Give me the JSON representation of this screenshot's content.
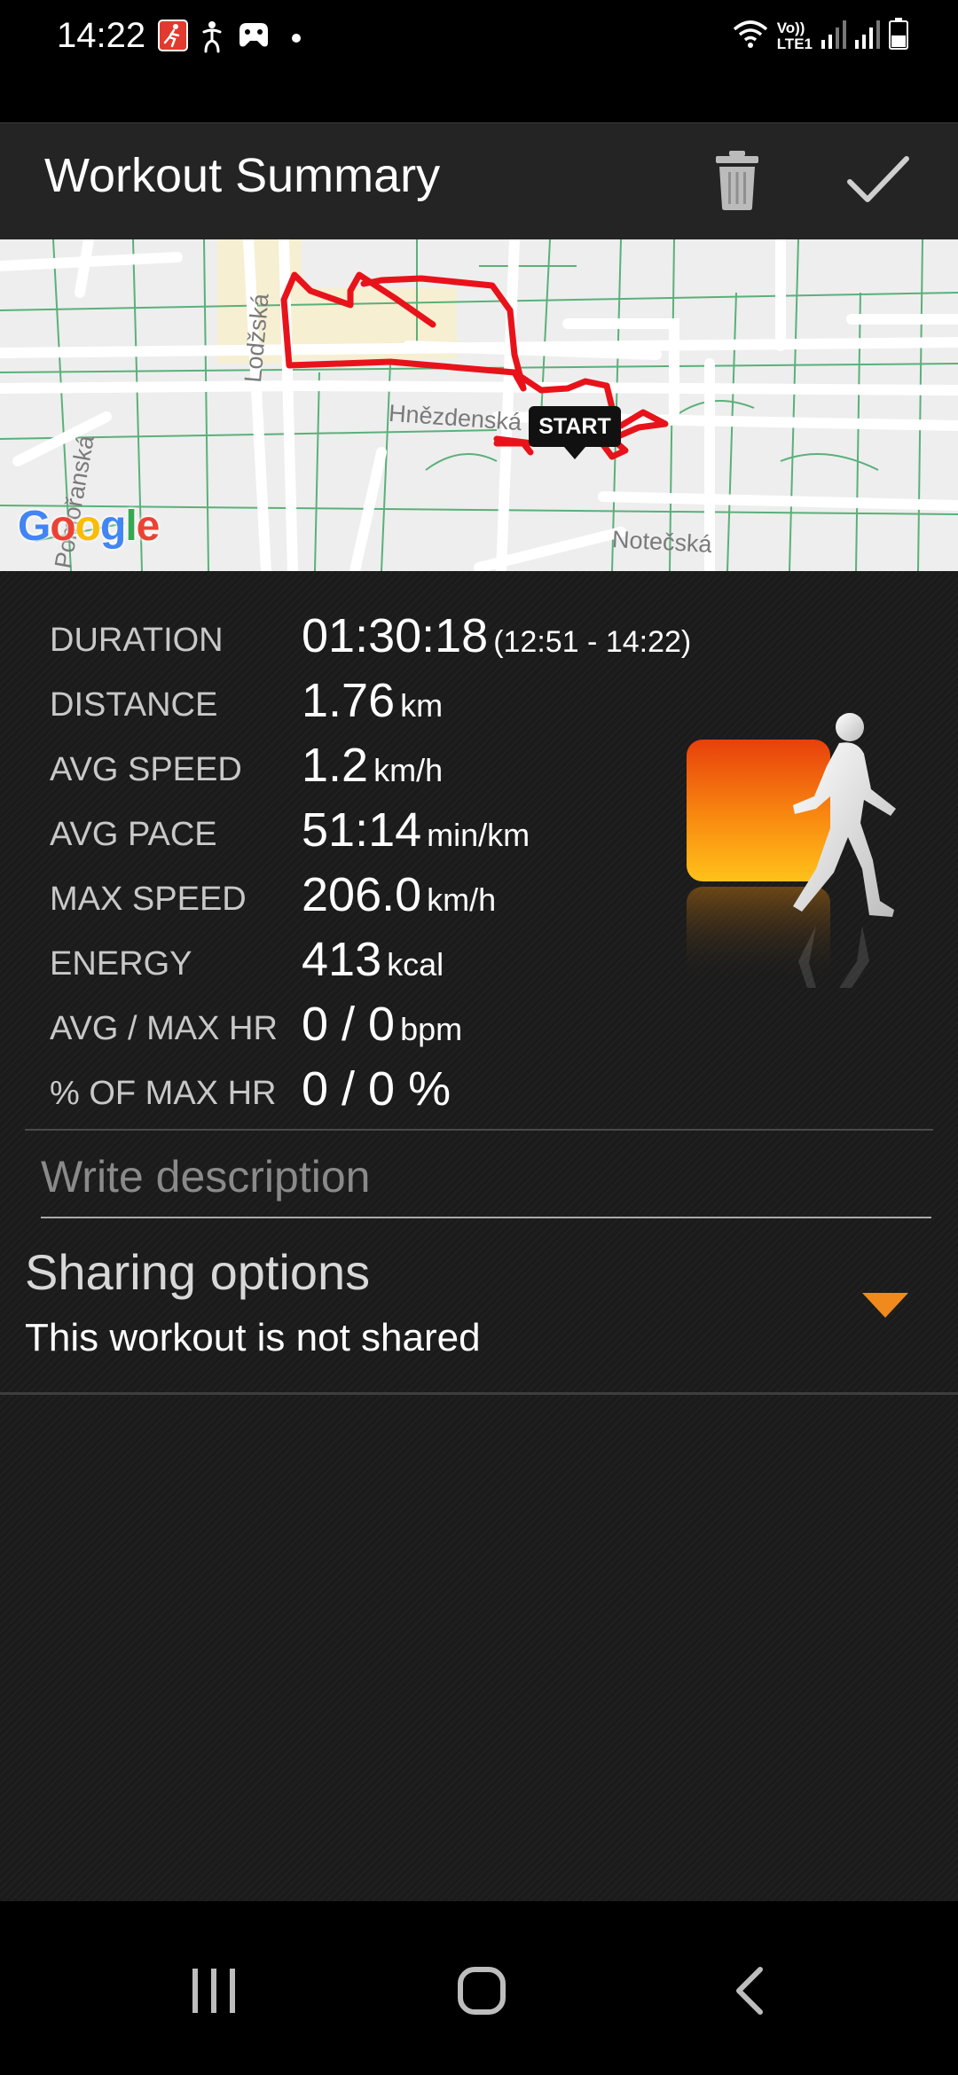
{
  "status_bar": {
    "time": "14:22",
    "notification_icons": [
      "running-app-icon",
      "accessibility-icon",
      "game-icon",
      "dot-icon"
    ],
    "network_label_top": "Vo))",
    "network_label_bottom": "LTE1",
    "right_icons": [
      "wifi-icon",
      "signal-icon",
      "signal-icon-2",
      "battery-icon"
    ]
  },
  "app_bar": {
    "title": "Workout Summary",
    "actions": [
      "delete-icon",
      "check-icon"
    ]
  },
  "map": {
    "streets": [
      "Lodžská",
      "Hnězdenská",
      "Notečská",
      "Pomořanská"
    ],
    "start_label": "START",
    "logo": "Google",
    "route_color": "#e8131a"
  },
  "stats": [
    {
      "label": "DURATION",
      "value": "01:30:18",
      "unit": "(12:51 - 14:22)"
    },
    {
      "label": "DISTANCE",
      "value": "1.76",
      "unit": "km"
    },
    {
      "label": "AVG SPEED",
      "value": "1.2",
      "unit": "km/h"
    },
    {
      "label": "AVG PACE",
      "value": "51:14",
      "unit": "min/km"
    },
    {
      "label": "MAX SPEED",
      "value": "206.0",
      "unit": "km/h"
    },
    {
      "label": "ENERGY",
      "value": "413",
      "unit": "kcal"
    },
    {
      "label": "AVG / MAX HR",
      "value": "0 / 0",
      "unit": "bpm"
    },
    {
      "label": "% OF MAX HR",
      "value": "0 / 0 %",
      "unit": ""
    }
  ],
  "description": {
    "placeholder": "Write description",
    "value": ""
  },
  "sharing": {
    "title": "Sharing options",
    "subtitle": "This workout is not shared",
    "accent_color": "#f08a1c"
  },
  "nav_bar": {
    "buttons": [
      "recent-apps-icon",
      "home-icon",
      "back-icon"
    ]
  }
}
